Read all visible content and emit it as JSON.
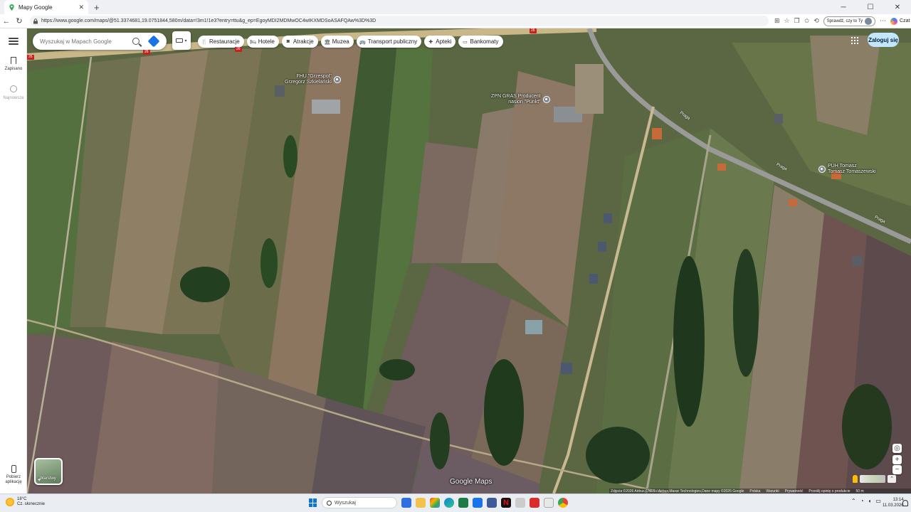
{
  "browser": {
    "tab_title": "Mapy Google",
    "url": "https://www.google.com/maps/@51.3374681,19.0751844,580m/data=!3m1!1e3?entry=ttu&g_ep=EgoyMDI2MDMwOC4wIKXMDSoASAFQAw%3D%3D",
    "check_label": "Sprawdź, czy to Ty",
    "copilot_label": "Czat"
  },
  "sidebar": {
    "saved_label": "Zapisano",
    "recent_label": "Najnowsze",
    "get_app_label": "Pobierz aplikację"
  },
  "search": {
    "placeholder": "Wyszukaj w Mapach Google"
  },
  "chips": [
    {
      "label": "Restauracje",
      "icon": "fork-knife-icon"
    },
    {
      "label": "Hotele",
      "icon": "bed-icon"
    },
    {
      "label": "Atrakcje",
      "icon": "camera-icon"
    },
    {
      "label": "Muzea",
      "icon": "museum-icon"
    },
    {
      "label": "Transport publiczny",
      "icon": "bus-icon"
    },
    {
      "label": "Apteki",
      "icon": "pharmacy-icon"
    },
    {
      "label": "Bankomaty",
      "icon": "atm-icon"
    }
  ],
  "header": {
    "login_label": "Zaloguj się"
  },
  "places": [
    {
      "name_line1": "FHU \"Grzespol\"",
      "name_line2": "Grzegorz Szkielański"
    },
    {
      "name_line1": "ZPN GRAS Producent",
      "name_line2": "nasion \"Punkt\""
    },
    {
      "name_line1": "PUH Tomasz",
      "name_line2": "Tomasz Tomaszewski"
    }
  ],
  "roads": {
    "street_name": "Praga",
    "route_number": "26"
  },
  "map": {
    "layers_label": "Warstwy",
    "logo_text": "Google Maps",
    "attribution": "Zdjęcia ©2026 Airbus,CNES / Airbus,Maxar Technologies,Dane mapy ©2026 Google",
    "footer_links": [
      "Polska",
      "Warunki",
      "Prywatność",
      "Prześlij opinię o produkcie"
    ],
    "scale_label": "50 m"
  },
  "taskbar": {
    "weather_temp": "18°C",
    "weather_desc": "Cz. słonecznie",
    "search_label": "Wyszukaj",
    "time": "13:14",
    "date": "11.03.2026"
  },
  "colors": {
    "accent": "#1a73e8",
    "login_bg": "#c2e7ff",
    "route_shield": "#c5221f"
  }
}
